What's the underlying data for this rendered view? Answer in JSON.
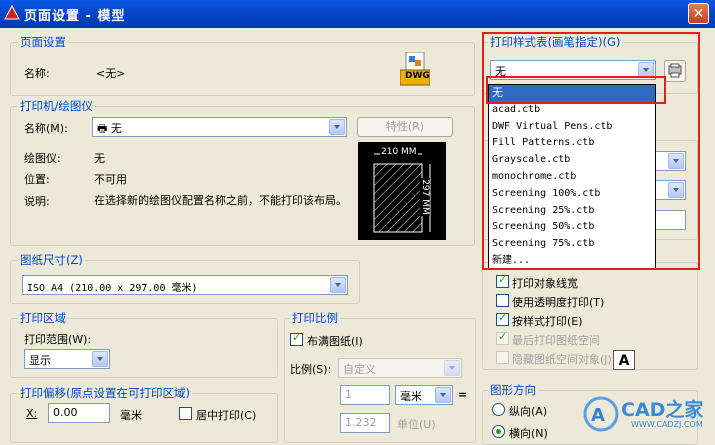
{
  "window": {
    "title": "页面设置 - 模型",
    "close_glyph": "✕"
  },
  "page_setup": {
    "group_label": "页面设置",
    "name_label": "名称:",
    "name_value": "<无>",
    "dwg_icon_text": "DWG"
  },
  "printer": {
    "group_label": "打印机/绘图仪",
    "name_label": "名称(M):",
    "name_value": "无",
    "properties_button": "特性(R)",
    "plotter_label": "绘图仪:",
    "plotter_value": "无",
    "location_label": "位置:",
    "location_value": "不可用",
    "description_label": "说明:",
    "description_value": "在选择新的绘图仪配置名称之前，不能打印该布局。",
    "preview_width": "210 MM",
    "preview_height": "297 MM"
  },
  "paper_size": {
    "group_label": "图纸尺寸(Z)",
    "value": "ISO A4 (210.00 x 297.00 毫米)"
  },
  "plot_area": {
    "group_label": "打印区域",
    "range_label": "打印范围(W):",
    "range_value": "显示"
  },
  "plot_offset": {
    "group_label": "打印偏移(原点设置在可打印区域)",
    "x_label": "X:",
    "x_value": "0.00",
    "x_unit": "毫米",
    "center_label": "居中打印(C)"
  },
  "plot_scale": {
    "group_label": "打印比例",
    "fit_label": "布满图纸(I)",
    "scale_label": "比例(S):",
    "scale_value": "自定义",
    "value1": "1",
    "unit_value": "毫米",
    "equals": "=",
    "value2": "1.232",
    "unit_label": "单位(U)"
  },
  "plot_style_table": {
    "group_label": "打印样式表(画笔指定)(G)",
    "current": "无",
    "options": [
      "无",
      "acad.ctb",
      "DWF Virtual Pens.ctb",
      "Fill Patterns.ctb",
      "Grayscale.ctb",
      "monochrome.ctb",
      "Screening 100%.ctb",
      "Screening 25%.ctb",
      "Screening 50%.ctb",
      "Screening 75%.ctb",
      "新建..."
    ]
  },
  "plot_options": {
    "items": [
      {
        "label": "打印对象线宽",
        "checked": true,
        "enabled": true
      },
      {
        "label": "使用透明度打印(T)",
        "checked": false,
        "enabled": true
      },
      {
        "label": "按样式打印(E)",
        "checked": true,
        "enabled": true
      },
      {
        "label": "最后打印图纸空间",
        "checked": true,
        "enabled": false
      },
      {
        "label": "隐藏图纸空间对象(J)",
        "checked": false,
        "enabled": false
      }
    ]
  },
  "orientation": {
    "group_label": "图形方向",
    "portrait_label": "纵向(A)",
    "landscape_label": "横向(N)"
  },
  "watermark": {
    "text": "CAD之家",
    "url": "WWW.CADZJ.COM"
  },
  "colors": {
    "title_bar": "#0645c8",
    "group_label": "#0046d5",
    "highlight": "#316ac5",
    "annotation_red": "#e0201a"
  }
}
